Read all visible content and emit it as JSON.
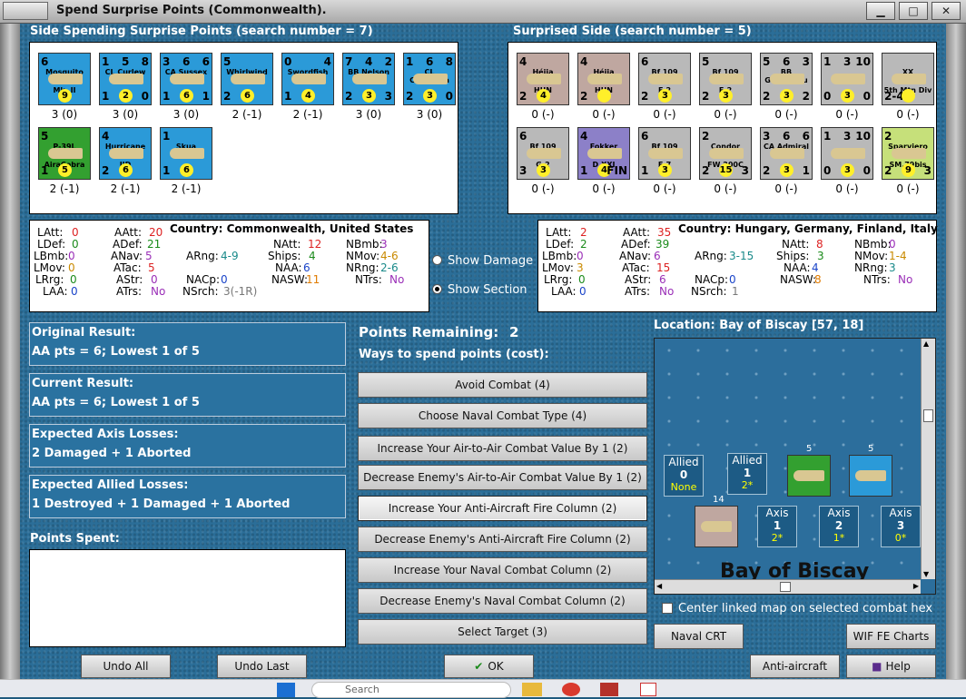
{
  "window": {
    "title": "Spend Surprise Points (Commonwealth)."
  },
  "left_side": {
    "header": "Side Spending Surprise Points (search number = 7)",
    "units": [
      {
        "name": "Mosquito",
        "sub": "Mk. II",
        "tl": "6",
        "tr": "",
        "bl": "",
        "bm": "9",
        "br": "",
        "cap": "3 (0)",
        "color": "blue"
      },
      {
        "name": "CL Curlew",
        "tl": "1",
        "tm": "5",
        "tr": "8",
        "bl": "1",
        "bm": "2",
        "br": "0",
        "cap": "3 (0)",
        "color": "blue"
      },
      {
        "name": "CA Sussex",
        "tl": "3",
        "tm": "6",
        "tr": "6",
        "bl": "1",
        "bm": "6",
        "br": "1",
        "cap": "3 (0)",
        "color": "blue"
      },
      {
        "name": "Whirlwind",
        "tl": "5",
        "tr": "",
        "bl": "2",
        "bm": "6",
        "br": "",
        "cap": "2 (-1)",
        "color": "blue"
      },
      {
        "name": "Swordfish",
        "tl": "0",
        "tr": "4",
        "bl": "1",
        "bm": "4",
        "br": "",
        "cap": "2 (-1)",
        "color": "blue"
      },
      {
        "name": "BB Nelson",
        "tl": "7",
        "tm": "4",
        "tr": "2",
        "bl": "2",
        "bm": "3",
        "br": "3",
        "cap": "3 (0)",
        "color": "blue"
      },
      {
        "name": "CL Cleopatra",
        "tl": "1",
        "tm": "6",
        "tr": "8",
        "bl": "2",
        "bm": "3",
        "br": "0",
        "cap": "3 (0)",
        "color": "blue"
      },
      {
        "name": "P-39L",
        "sub": "AiraCobra",
        "tl": "5",
        "tr": "",
        "bl": "1",
        "bm": "5",
        "br": "",
        "cap": "2 (-1)",
        "color": "green"
      },
      {
        "name": "Hurricane",
        "sub": "IID",
        "tl": "4",
        "tr": "",
        "bl": "2",
        "bm": "6",
        "br": "",
        "cap": "2 (-1)",
        "color": "blue"
      },
      {
        "name": "Skua",
        "tl": "1",
        "tr": "",
        "bl": "1",
        "bm": "6",
        "br": "",
        "cap": "2 (-1)",
        "color": "blue"
      }
    ]
  },
  "right_side": {
    "header": "Surprised Side (search number = 5)",
    "units": [
      {
        "name": "Héjja",
        "sub": "HUN",
        "tl": "4",
        "bl": "2",
        "bm": "4",
        "br": "",
        "cap": "0 (-)",
        "color": "tan"
      },
      {
        "name": "Héjja",
        "sub": "HUN",
        "tl": "4",
        "bl": "2",
        "bm": "",
        "br": "",
        "cap": "0 (-)",
        "color": "tan"
      },
      {
        "name": "Bf 109",
        "sub": "F-2",
        "tl": "6",
        "bl": "2",
        "bm": "3",
        "br": "",
        "cap": "0 (-)",
        "color": "gray"
      },
      {
        "name": "Bf 109",
        "sub": "E-2",
        "tl": "5",
        "bl": "2",
        "bm": "3",
        "br": "",
        "cap": "0 (-)",
        "color": "gray"
      },
      {
        "name": "BB Gneisenau",
        "tl": "5",
        "tm": "6",
        "tr": "3",
        "bl": "2",
        "bm": "3",
        "br": "2",
        "cap": "0 (-)",
        "color": "gray"
      },
      {
        "name": "",
        "tl": "1",
        "tm": "3",
        "tr": "10",
        "bl": "0",
        "bm": "3",
        "br": "0",
        "cap": "0 (-)",
        "color": "gray"
      },
      {
        "name": "XX",
        "sub": "5th Mtn Div",
        "tl": "",
        "bl": "2-4",
        "bm": "",
        "br": "",
        "cap": "0 (-)",
        "color": "gray"
      },
      {
        "name": "Bf 109",
        "sub": "G-2",
        "tl": "6",
        "bl": "3",
        "bm": "3",
        "br": "",
        "cap": "0 (-)",
        "color": "gray"
      },
      {
        "name": "Fokker",
        "sub": "D.XXI",
        "tl": "4",
        "bl": "1",
        "bm": "4",
        "br": "FIN",
        "cap": "0 (-)",
        "color": "purple"
      },
      {
        "name": "Bf 109",
        "sub": "E-7",
        "tl": "6",
        "bl": "1",
        "bm": "3",
        "br": "",
        "cap": "0 (-)",
        "color": "gray"
      },
      {
        "name": "Condor",
        "sub": "FW 200C",
        "tl": "2",
        "bl": "2",
        "bm": "15",
        "br": "3",
        "cap": "0 (-)",
        "color": "gray"
      },
      {
        "name": "CA Admiral Hipper",
        "tl": "3",
        "tm": "6",
        "tr": "6",
        "bl": "2",
        "bm": "3",
        "br": "1",
        "cap": "0 (-)",
        "color": "gray"
      },
      {
        "name": "",
        "tl": "1",
        "tm": "3",
        "tr": "10",
        "bl": "0",
        "bm": "3",
        "br": "0",
        "cap": "0 (-)",
        "color": "gray"
      },
      {
        "name": "Sparviero",
        "sub": "SM.79bis",
        "tl": "2",
        "bl": "2",
        "bm": "9",
        "br": "3",
        "cap": "0 (-)",
        "color": "yellow"
      }
    ]
  },
  "left_stats": {
    "country": "Country: Commonwealth, United States",
    "LAtt": "0",
    "LDef": "0",
    "LBmb": "0",
    "LMov": "0",
    "LRrg": "0",
    "LAA": "0",
    "AAtt": "20",
    "ADef": "21",
    "ANav": "5",
    "ATac": "5",
    "AStr": "0",
    "ATrs": "No",
    "ARng": "4-9",
    "NACp": "0",
    "NSrch": "3(-1R)",
    "NAtt": "12",
    "Ships": "4",
    "NAA": "6",
    "NASW": "11",
    "NBmb": "3",
    "NMov": "4-6",
    "NRng": "2-6",
    "NTrs": "No"
  },
  "right_stats": {
    "country": "Country: Hungary, Germany, Finland, Italy",
    "LAtt": "2",
    "LDef": "2",
    "LBmb": "0",
    "LMov": "3",
    "LRrg": "0",
    "LAA": "0",
    "AAtt": "35",
    "ADef": "39",
    "ANav": "6",
    "ATac": "15",
    "AStr": "6",
    "ATrs": "No",
    "ARng": "3-15",
    "NACp": "0",
    "NSrch": "1",
    "NAtt": "8",
    "Ships": "3",
    "NAA": "4",
    "NASW": "8",
    "NBmb": "0",
    "NMov": "1-4",
    "NRng": "3",
    "NTrs": "No"
  },
  "labels": {
    "LAtt": "LAtt:",
    "LDef": "LDef:",
    "LBmb": "LBmb:",
    "LMov": "LMov:",
    "LRrg": "LRrg:",
    "LAA": "LAA:",
    "AAtt": "AAtt:",
    "ADef": "ADef:",
    "ANav": "ANav:",
    "ATac": "ATac:",
    "AStr": "AStr:",
    "ATrs": "ATrs:",
    "ARng": "ARng:",
    "NACp": "NACp:",
    "NSrch": "NSrch:",
    "NAtt": "NAtt:",
    "Ships": "Ships:",
    "NAA": "NAA:",
    "NASW": "NASW:",
    "NBmb": "NBmb:",
    "NMov": "NMov:",
    "NRng": "NRng:",
    "NTrs": "NTrs:"
  },
  "radios": {
    "damage": "Show Damage",
    "section": "Show Section"
  },
  "results": {
    "orig_title": "Original Result:",
    "orig_val": "AA pts = 6; Lowest 1 of 5",
    "curr_title": "Current Result:",
    "curr_val": "AA pts = 6; Lowest 1 of 5",
    "axis_title": "Expected Axis Losses:",
    "axis_val": "2 Damaged + 1 Aborted",
    "allied_title": "Expected Allied Losses:",
    "allied_val": "1 Destroyed + 1 Damaged + 1 Aborted",
    "spent_title": "Points Spent:"
  },
  "points": {
    "label": "Points Remaining:",
    "value": "2",
    "ways": "Ways to spend points (cost):"
  },
  "options": [
    "Avoid Combat (4)",
    "Choose Naval Combat Type (4)",
    "Increase Your Air-to-Air Combat Value By 1 (2)",
    "Decrease Enemy's Air-to-Air Combat Value By 1 (2)",
    "Increase Your Anti-Aircraft Fire Column (2)",
    "Decrease Enemy's Anti-Aircraft Fire Column (2)",
    "Increase Your Naval Combat Column (2)",
    "Decrease Enemy's Naval Combat Column (2)",
    "Select Target (3)"
  ],
  "location": {
    "title": "Location: Bay of Biscay [57, 18]",
    "map_label": "Bay of Biscay",
    "allied0": "Allied",
    "allied0_n": "0",
    "allied0_v": "None",
    "allied1": "Allied",
    "allied1_n": "1",
    "allied1_v": "2*",
    "axis1": "Axis",
    "axis1_n": "1",
    "axis1_v": "2*",
    "axis2": "Axis",
    "axis2_n": "2",
    "axis2_v": "1*",
    "axis3": "Axis",
    "axis3_n": "3",
    "axis3_v": "0*",
    "stack5a": "5",
    "stack5b": "5",
    "stack14": "14"
  },
  "center_check": "Center linked map on selected combat hex",
  "buttons": {
    "undo_all": "Undo All",
    "undo_last": "Undo Last",
    "ok": "OK",
    "naval_crt": "Naval CRT",
    "wif_charts": "WIF FE Charts",
    "aa_crt": "Anti-aircraft CRT",
    "help": "Help"
  },
  "taskbar": {
    "search": "Search"
  }
}
